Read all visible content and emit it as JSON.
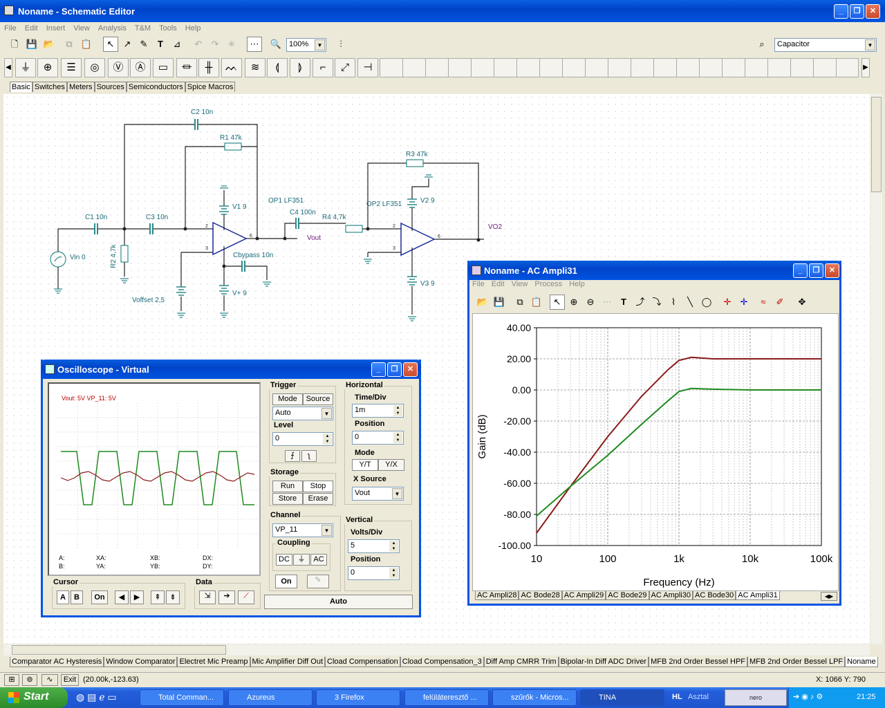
{
  "app": {
    "title": "Noname - Schematic Editor"
  },
  "menu": [
    "File",
    "Edit",
    "Insert",
    "View",
    "Analysis",
    "T&M",
    "Tools",
    "Help"
  ],
  "toolbar": {
    "zoom": "100%",
    "component": "Capacitor"
  },
  "component_tabs": [
    "Basic",
    "Switches",
    "Meters",
    "Sources",
    "Semiconductors",
    "Spice Macros"
  ],
  "schematic": {
    "labels": {
      "c2": "C2 10n",
      "r1": "R1 47k",
      "c1": "C1 10n",
      "c3": "C3 10n",
      "r2": "R2 4,7k",
      "vin": "Vin 0",
      "v1": "V1 9",
      "op1": "OP1 LF351",
      "c4": "C4 100n",
      "r4": "R4 4,7k",
      "vout": "Vout",
      "cbypass": "Cbypass 10n",
      "vplus": "V+ 9",
      "voffset": "Voffset 2,5",
      "r3": "R3 47k",
      "op2": "OP2 LF351",
      "v2": "V2 9",
      "vo2": "VO2",
      "v3": "V3 9"
    }
  },
  "bottom_tabs": [
    "Comparator AC Hysteresis",
    "Window Comparator",
    "Electret Mic Preamp",
    "Mic Amplifier Diff Out",
    "Cload Compensation",
    "Cload Compensation_3",
    "Diff Amp CMRR Trim",
    "Bipolar-In Diff ADC Driver",
    "MFB 2nd Order Bessel HPF",
    "MFB 2nd Order Bessel LPF",
    "Noname"
  ],
  "status": {
    "exit": "Exit",
    "coords": "(20.00k,-123.63)",
    "cursor": "X: 1066  Y: 790"
  },
  "oscilloscope": {
    "title": "Oscilloscope - Virtual",
    "channel_readout": "Vout: 5V   VP_11: 5V",
    "cursor_readouts": {
      "a": "A:",
      "b": "B:",
      "xa": "XA:",
      "ya": "YA:",
      "xb": "XB:",
      "yb": "YB:",
      "dx": "DX:",
      "dy": "DY:"
    },
    "trigger": {
      "label": "Trigger",
      "mode": "Mode",
      "source": "Source",
      "mode_value": "Auto",
      "level_label": "Level",
      "level": "0"
    },
    "horizontal": {
      "label": "Horizontal",
      "time_div_label": "Time/Div",
      "time_div": "1m",
      "position_label": "Position",
      "position": "0",
      "mode_label": "Mode",
      "yt": "Y/T",
      "yx": "Y/X",
      "xsource_label": "X Source",
      "xsource": "Vout"
    },
    "storage": {
      "label": "Storage",
      "run": "Run",
      "stop": "Stop",
      "store": "Store",
      "erase": "Erase"
    },
    "channel": {
      "label": "Channel",
      "value": "VP_11",
      "coupling_label": "Coupling",
      "dc": "DC",
      "ac": "AC",
      "on": "On"
    },
    "vertical": {
      "label": "Vertical",
      "volts_div_label": "Volts/Div",
      "volts_div": "5",
      "position_label": "Position",
      "position": "0"
    },
    "cursor": {
      "label": "Cursor",
      "a": "A",
      "b": "B",
      "on": "On"
    },
    "data_label": "Data",
    "auto": "Auto"
  },
  "analyzer": {
    "title": "Noname - AC Ampli31",
    "menu": [
      "File",
      "Edit",
      "View",
      "Process",
      "Help"
    ],
    "tabs": [
      "AC Ampli28",
      "AC Bode28",
      "AC Ampli29",
      "AC Bode29",
      "AC Ampli30",
      "AC Bode30",
      "AC Ampli31"
    ]
  },
  "chart_data": {
    "type": "line",
    "title": "",
    "xlabel": "Frequency (Hz)",
    "ylabel": "Gain (dB)",
    "xscale": "log",
    "xlim": [
      10,
      100000
    ],
    "ylim": [
      -100,
      40
    ],
    "xticks": [
      "10",
      "100",
      "1k",
      "10k",
      "100k"
    ],
    "yticks": [
      "40.00",
      "20.00",
      "0.00",
      "-20.00",
      "-40.00",
      "-60.00",
      "-80.00",
      "-100.00"
    ],
    "grid": true,
    "series": [
      {
        "color": "#8b1a1a",
        "x": [
          10,
          30,
          100,
          300,
          700,
          1000,
          1500,
          3000,
          10000,
          100000
        ],
        "y": [
          -92,
          -62,
          -30,
          -4,
          13,
          19,
          21,
          20,
          20,
          20
        ]
      },
      {
        "color": "#1f8a1f",
        "x": [
          10,
          30,
          100,
          300,
          700,
          1000,
          1500,
          3000,
          10000,
          100000
        ],
        "y": [
          -81,
          -62,
          -42,
          -22,
          -7,
          -1,
          1,
          0.5,
          0,
          0
        ]
      }
    ]
  },
  "taskbar": {
    "start": "Start",
    "tasks": [
      "Total Comman...",
      "Azureus",
      "3 Firefox",
      "felüláteresztő ...",
      "szűrők - Micros...",
      "TINA"
    ],
    "tray_lang": "HL",
    "tray_text": "Asztal",
    "clock": "21:25"
  }
}
